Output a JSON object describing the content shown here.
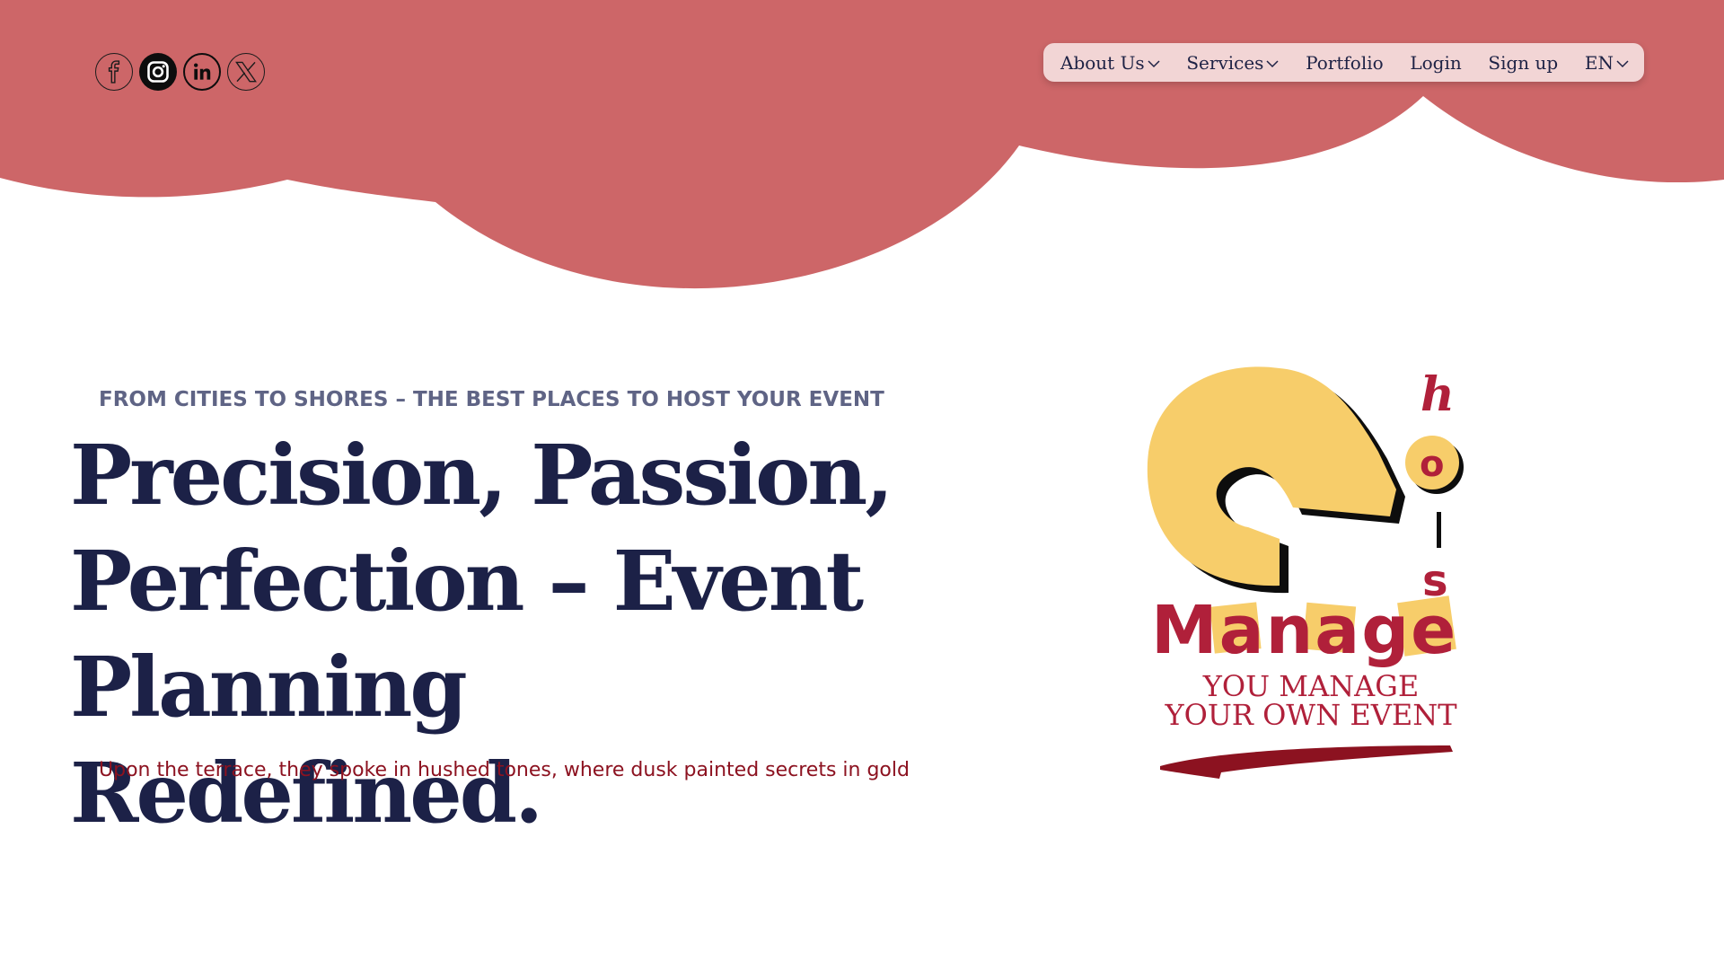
{
  "header": {
    "social": [
      {
        "name": "facebook",
        "icon": "facebook-icon"
      },
      {
        "name": "instagram",
        "icon": "instagram-icon"
      },
      {
        "name": "linkedin",
        "icon": "linkedin-icon"
      },
      {
        "name": "x",
        "icon": "x-icon"
      }
    ],
    "nav": {
      "about_label": "About Us",
      "services_label": "Services",
      "portfolio_label": "Portfolio",
      "login_label": "Login",
      "signup_label": "Sign up",
      "language_label": "EN"
    }
  },
  "hero": {
    "eyebrow": "FROM CITIES TO SHORES – THE BEST PLACES TO HOST YOUR EVENT",
    "headline_line1": "Precision, Passion,",
    "headline_line2": "Perfection – Event",
    "headline_line3": "Planning Redefined.",
    "subline": "Upon the terrace, they spoke in hushed tones, where dusk painted secrets in gold"
  },
  "logo": {
    "word": "Manage",
    "vertical_word": "hois",
    "tagline_line1": "YOU MANAGE",
    "tagline_line2": "YOUR OWN EVENT"
  },
  "colors": {
    "brand_coral": "#cd6668",
    "nav_pill": "#f2d5d5",
    "navy": "#1c2147",
    "eyebrow_gray": "#5f6485",
    "accent_red": "#8c1220",
    "logo_yellow": "#f7cd6a",
    "logo_crimson": "#b0203a"
  }
}
